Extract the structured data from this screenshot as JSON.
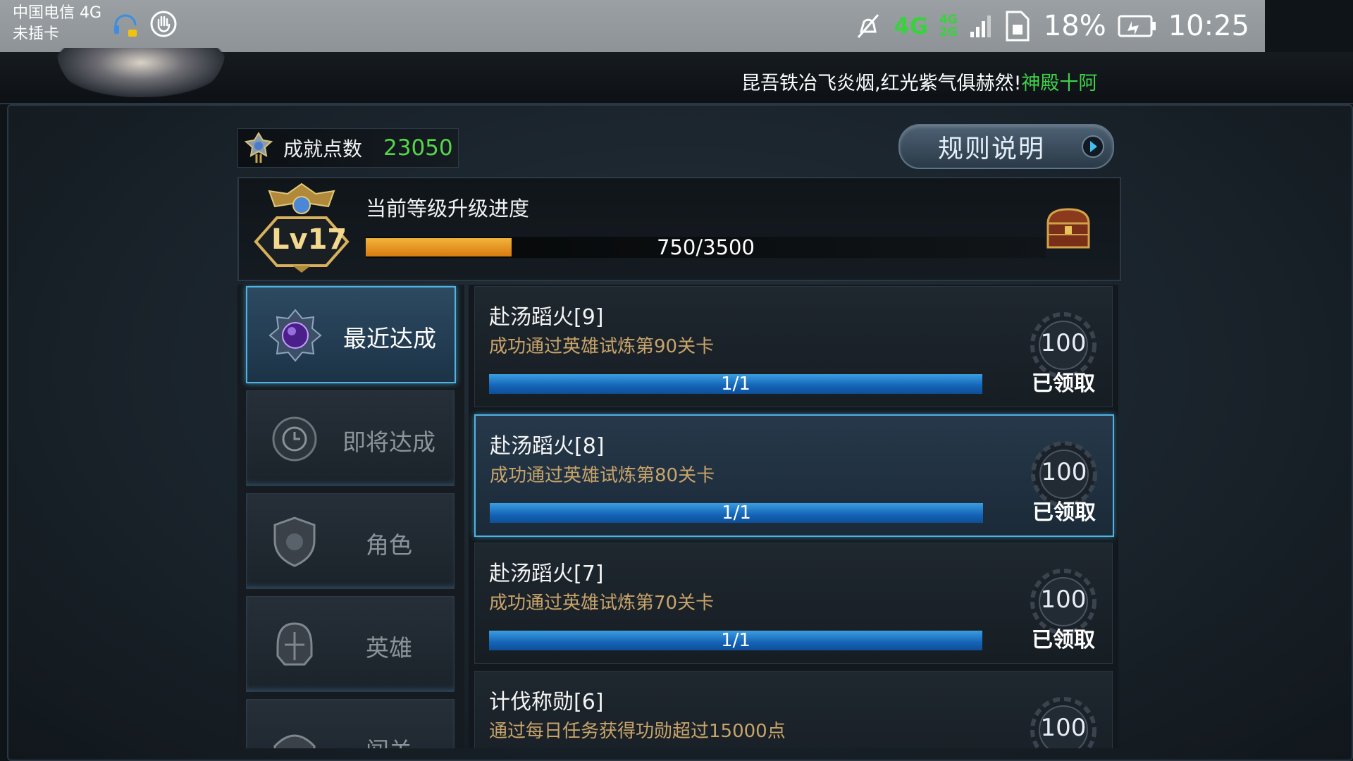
{
  "status_bar": {
    "carrier": "中国电信 4G",
    "sim_status": "未插卡",
    "network_main": "4G",
    "network_top": "4G",
    "network_bottom": "2G",
    "battery": "18%",
    "time": "10:25"
  },
  "marquee": {
    "text": "昆吾铁冶飞炎烟,红光紫气俱赫然!",
    "highlight": "神殿十阿"
  },
  "achievement_points": {
    "label": "成就点数",
    "value": "23050"
  },
  "rules_button": {
    "label": "规则说明"
  },
  "level": {
    "badge": "Lv17",
    "title": "当前等级升级进度",
    "progress_text": "750/3500",
    "progress_fraction": 0.214
  },
  "sidebar": {
    "items": [
      {
        "label": "最近达成",
        "icon": "recent-orb-icon",
        "active": true
      },
      {
        "label": "即将达成",
        "icon": "clock-emblem-icon",
        "active": false
      },
      {
        "label": "角色",
        "icon": "shield-emblem-icon",
        "active": false
      },
      {
        "label": "英雄",
        "icon": "helmet-emblem-icon",
        "active": false
      },
      {
        "label": "闯关",
        "icon": "gate-emblem-icon",
        "active": false
      }
    ]
  },
  "achievements": [
    {
      "title": "赴汤蹈火[9]",
      "desc": "成功通过英雄试炼第90关卡",
      "progress_text": "1/1",
      "progress_fraction": 1,
      "reward": "100",
      "status": "已领取",
      "highlight": false
    },
    {
      "title": "赴汤蹈火[8]",
      "desc": "成功通过英雄试炼第80关卡",
      "progress_text": "1/1",
      "progress_fraction": 1,
      "reward": "100",
      "status": "已领取",
      "highlight": true
    },
    {
      "title": "赴汤蹈火[7]",
      "desc": "成功通过英雄试炼第70关卡",
      "progress_text": "1/1",
      "progress_fraction": 1,
      "reward": "100",
      "status": "已领取",
      "highlight": false
    },
    {
      "title": "计伐称勋[6]",
      "desc": "通过每日任务获得功勋超过15000点",
      "progress_text": "",
      "progress_fraction": 0,
      "reward": "100",
      "status": "",
      "highlight": false
    }
  ],
  "colors": {
    "accent_blue": "#4fb4e4",
    "points_green": "#56d64a",
    "level_orange": "#e89a22",
    "desc_gold": "#c8a46a"
  }
}
